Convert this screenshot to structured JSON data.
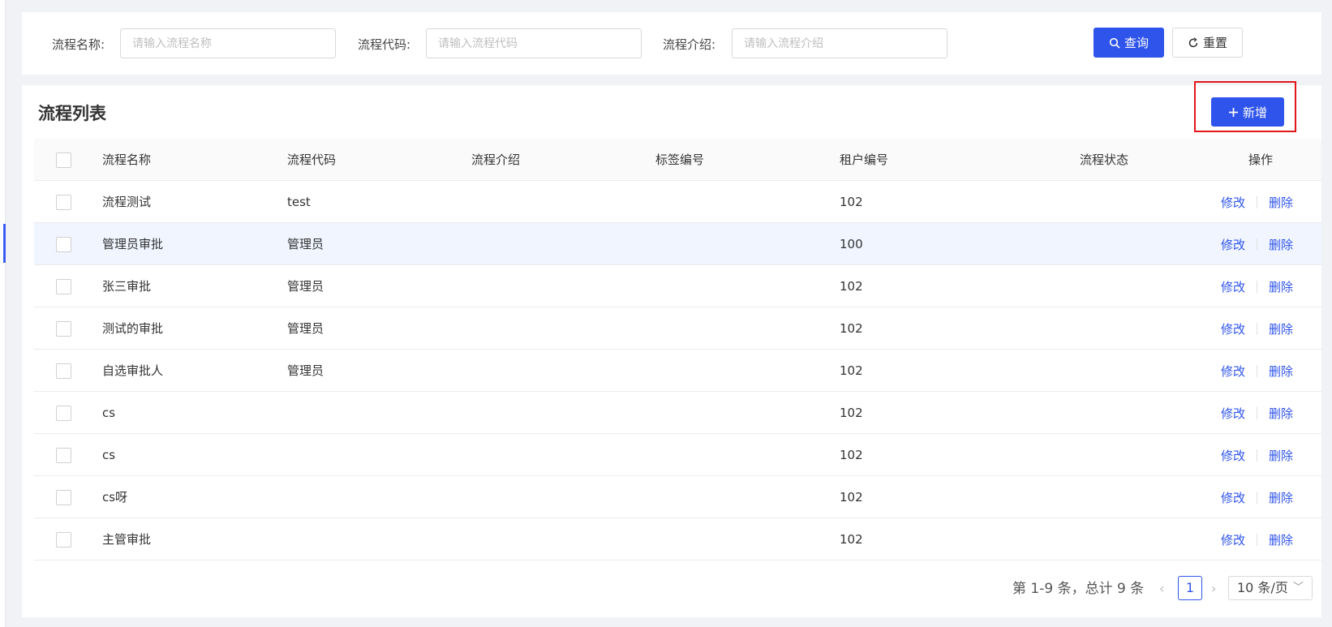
{
  "search": {
    "fields": [
      {
        "label": "流程名称:",
        "placeholder": "请输入流程名称",
        "value": ""
      },
      {
        "label": "流程代码:",
        "placeholder": "请输入流程代码",
        "value": ""
      },
      {
        "label": "流程介绍:",
        "placeholder": "请输入流程介绍",
        "value": ""
      }
    ],
    "query_label": "查询",
    "reset_label": "重置"
  },
  "list": {
    "title": "流程列表",
    "add_label": "新增",
    "columns": [
      "流程名称",
      "流程代码",
      "流程介绍",
      "标签编号",
      "租户编号",
      "流程状态",
      "操作"
    ],
    "rows": [
      {
        "name": "流程测试",
        "code": "test",
        "intro": "",
        "tag": "",
        "tenant": "102",
        "status": ""
      },
      {
        "name": "管理员审批",
        "code": "管理员",
        "intro": "",
        "tag": "",
        "tenant": "100",
        "status": ""
      },
      {
        "name": "张三审批",
        "code": "管理员",
        "intro": "",
        "tag": "",
        "tenant": "102",
        "status": ""
      },
      {
        "name": "测试的审批",
        "code": "管理员",
        "intro": "",
        "tag": "",
        "tenant": "102",
        "status": ""
      },
      {
        "name": "自选审批人",
        "code": "管理员",
        "intro": "",
        "tag": "",
        "tenant": "102",
        "status": ""
      },
      {
        "name": "cs",
        "code": "",
        "intro": "",
        "tag": "",
        "tenant": "102",
        "status": ""
      },
      {
        "name": "cs",
        "code": "",
        "intro": "",
        "tag": "",
        "tenant": "102",
        "status": ""
      },
      {
        "name": "cs呀",
        "code": "",
        "intro": "",
        "tag": "",
        "tenant": "102",
        "status": ""
      },
      {
        "name": "主管审批",
        "code": "",
        "intro": "",
        "tag": "",
        "tenant": "102",
        "status": ""
      }
    ],
    "edit_label": "修改",
    "delete_label": "删除"
  },
  "pagination": {
    "total_text": "第 1-9 条，总计 9 条",
    "current_page": "1",
    "page_size": "10 条/页",
    "prev_icon": "‹",
    "next_icon": "›"
  },
  "colors": {
    "primary": "#2f54eb",
    "highlight_border": "#e0161b",
    "hover_row": "#f0f5ff"
  }
}
